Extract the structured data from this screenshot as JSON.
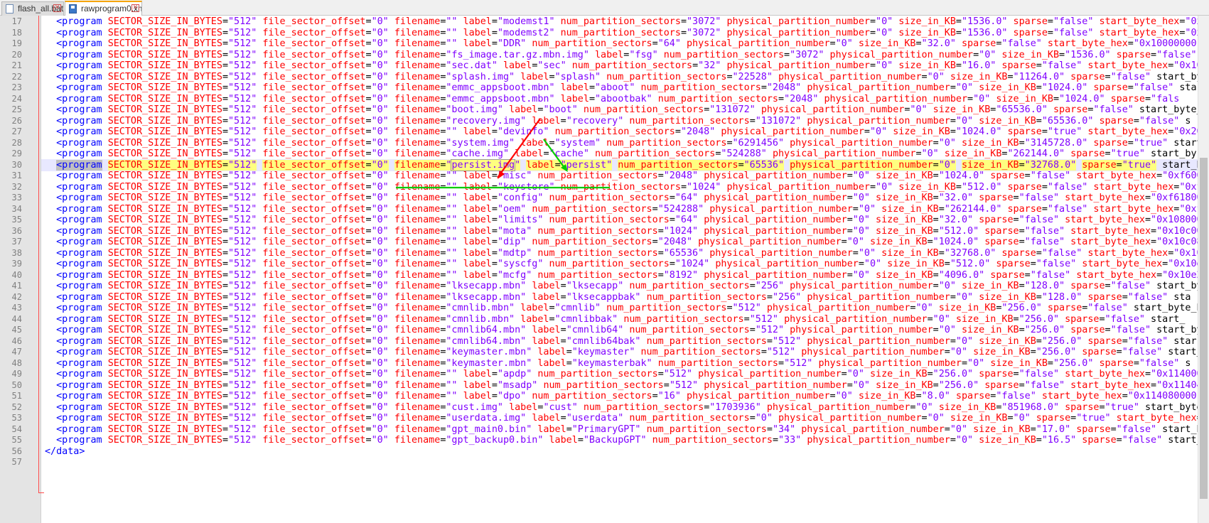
{
  "tabs": [
    {
      "label": "flash_all.bat",
      "active": false
    },
    {
      "label": "rawprogram0.xml",
      "active": true
    }
  ],
  "colors": {
    "tag": "#0000ff",
    "attribute": "#ff0000",
    "value": "#8000ff",
    "current_line": "#e8e8ff",
    "fold_marker": "#ff4a4a",
    "arrow_red": "#ff0000",
    "arrow_green": "#00cc00"
  },
  "editor": {
    "current_line": 30,
    "highlight_value": "persist.img",
    "lines": [
      {
        "n": "17",
        "code": "  <program SECTOR_SIZE_IN_BYTES=\"512\" file_sector_offset=\"0\" filename=\"\" label=\"modemst1\" num_partition_sectors=\"3072\" physical_partition_number=\"0\" size_in_KB=\"1536.0\" sparse=\"false\" start_byte_hex=\"0xc"
      },
      {
        "n": "18",
        "code": "  <program SECTOR_SIZE_IN_BYTES=\"512\" file_sector_offset=\"0\" filename=\"\" label=\"modemst2\" num_partition_sectors=\"3072\" physical_partition_number=\"0\" size_in_KB=\"1536.0\" sparse=\"false\" start_byte_hex=\"0xc"
      },
      {
        "n": "19",
        "code": "  <program SECTOR_SIZE_IN_BYTES=\"512\" file_sector_offset=\"0\" filename=\"\" label=\"DDR\" num_partition_sectors=\"64\" physical_partition_number=\"0\" size_in_KB=\"32.0\" sparse=\"false\" start_byte_hex=\"0x10000000"
      },
      {
        "n": "20",
        "code": "  <program SECTOR_SIZE_IN_BYTES=\"512\" file_sector_offset=\"0\" filename=\"fs_image.tar.gz.mbn.img\" label=\"fsg\" num_partition_sectors=\"3072\" physical_partition_number=\"0\" size_in_KB=\"1536.0\" sparse=\"false\" s"
      },
      {
        "n": "21",
        "code": "  <program SECTOR_SIZE_IN_BYTES=\"512\" file_sector_offset=\"0\" filename=\"sec.dat\" label=\"sec\" num_partition_sectors=\"32\" physical_partition_number=\"0\" size_in_KB=\"16.0\" sparse=\"false\" start_byte_hex=\"0x101"
      },
      {
        "n": "22",
        "code": "  <program SECTOR_SIZE_IN_BYTES=\"512\" file_sector_offset=\"0\" filename=\"splash.img\" label=\"splash\" num_partition_sectors=\"22528\" physical_partition_number=\"0\" size_in_KB=\"11264.0\" sparse=\"false\" start_byt"
      },
      {
        "n": "23",
        "code": "  <program SECTOR_SIZE_IN_BYTES=\"512\" file_sector_offset=\"0\" filename=\"emmc_appsboot.mbn\" label=\"aboot\" num_partition_sectors=\"2048\" physical_partition_number=\"0\" size_in_KB=\"1024.0\" sparse=\"false\" start"
      },
      {
        "n": "24",
        "code": "  <program SECTOR_SIZE_IN_BYTES=\"512\" file_sector_offset=\"0\" filename=\"emmc_appsboot.mbn\" label=\"abootbak\" num_partition_sectors=\"2048\" physical_partition_number=\"0\" size_in_KB=\"1024.0\" sparse=\"fals"
      },
      {
        "n": "25",
        "code": "  <program SECTOR_SIZE_IN_BYTES=\"512\" file_sector_offset=\"0\" filename=\"boot.img\" label=\"boot\" num_partition_sectors=\"131072\" physical_partition_number=\"0\" size_in_KB=\"65536.0\" sparse=\"false\" start_byte_h"
      },
      {
        "n": "26",
        "code": "  <program SECTOR_SIZE_IN_BYTES=\"512\" file_sector_offset=\"0\" filename=\"recovery.img\" label=\"recovery\" num_partition_sectors=\"131072\" physical_partition_number=\"0\" size_in_KB=\"65536.0\" sparse=\"false\" s"
      },
      {
        "n": "27",
        "code": "  <program SECTOR_SIZE_IN_BYTES=\"512\" file_sector_offset=\"0\" filename=\"\" label=\"devinfo\" num_partition_sectors=\"2048\" physical_partition_number=\"0\" size_in_KB=\"1024.0\" sparse=\"true\" start_byte_hex=\"0x202"
      },
      {
        "n": "28",
        "code": "  <program SECTOR_SIZE_IN_BYTES=\"512\" file_sector_offset=\"0\" filename=\"system.img\" label=\"system\" num_partition_sectors=\"6291456\" physical_partition_number=\"0\" size_in_KB=\"3145728.0\" sparse=\"true\" start_"
      },
      {
        "n": "29",
        "code": "  <program SECTOR_SIZE_IN_BYTES=\"512\" file_sector_offset=\"0\" filename=\"cache.img\" label=\"cache\" num_partition_sectors=\"524288\" physical_partition_number=\"0\" size_in_KB=\"262144.0\" sparse=\"true\" start_by"
      },
      {
        "n": "30",
        "code": "  <program SECTOR_SIZE_IN_BYTES=\"512\" file_sector_offset=\"0\" filename=\"persist.img\" label=\"persist\" num_partition_sectors=\"65536\" physical_partition_number=\"0\" size_in_KB=\"32768.0\" sparse=\"true\" start_by"
      },
      {
        "n": "31",
        "code": "  <program SECTOR_SIZE_IN_BYTES=\"512\" file_sector_offset=\"0\" filename=\"\" label=\"misc\" num_partition_sectors=\"2048\" physical_partition_number=\"0\" size_in_KB=\"1024.0\" sparse=\"false\" start_byte_hex=\"0xf6000"
      },
      {
        "n": "32",
        "code": "  <program SECTOR_SIZE_IN_BYTES=\"512\" file_sector_offset=\"0\" filename=\"\" label=\"keystore\" num_partition_sectors=\"1024\" physical_partition_number=\"0\" size_in_KB=\"512.0\" sparse=\"false\" start_byte_hex=\"0xf6"
      },
      {
        "n": "33",
        "code": "  <program SECTOR_SIZE_IN_BYTES=\"512\" file_sector_offset=\"0\" filename=\"\" label=\"config\" num_partition_sectors=\"64\" physical_partition_number=\"0\" size_in_KB=\"32.0\" sparse=\"false\" start_byte_hex=\"0xf61800"
      },
      {
        "n": "34",
        "code": "  <program SECTOR_SIZE_IN_BYTES=\"512\" file_sector_offset=\"0\" filename=\"\" label=\"oem\" num_partition_sectors=\"524288\" physical_partition_number=\"0\" size_in_KB=\"262144.0\" sparse=\"false\" start_byte_hex=\"0xf6"
      },
      {
        "n": "35",
        "code": "  <program SECTOR_SIZE_IN_BYTES=\"512\" file_sector_offset=\"0\" filename=\"\" label=\"limits\" num_partition_sectors=\"64\" physical_partition_number=\"0\" size_in_KB=\"32.0\" sparse=\"false\" start_byte_hex=\"0x108000"
      },
      {
        "n": "36",
        "code": "  <program SECTOR_SIZE_IN_BYTES=\"512\" file_sector_offset=\"0\" filename=\"\" label=\"mota\" num_partition_sectors=\"1024\" physical_partition_number=\"0\" size_in_KB=\"512.0\" sparse=\"false\" start_byte_hex=\"0x10c00"
      },
      {
        "n": "37",
        "code": "  <program SECTOR_SIZE_IN_BYTES=\"512\" file_sector_offset=\"0\" filename=\"\" label=\"dip\" num_partition_sectors=\"2048\" physical_partition_number=\"0\" size_in_KB=\"1024.0\" sparse=\"false\" start_byte_hex=\"0x10c08"
      },
      {
        "n": "38",
        "code": "  <program SECTOR_SIZE_IN_BYTES=\"512\" file_sector_offset=\"0\" filename=\"\" label=\"mdtp\" num_partition_sectors=\"65536\" physical_partition_number=\"0\" size_in_KB=\"32768.0\" sparse=\"false\" start_byte_hex=\"0x10c"
      },
      {
        "n": "39",
        "code": "  <program SECTOR_SIZE_IN_BYTES=\"512\" file_sector_offset=\"0\" filename=\"\" label=\"syscfg\" num_partition_sectors=\"1024\" physical_partition_number=\"0\" size_in_KB=\"512.0\" sparse=\"false\" start_byte_hex=\"0x10e1"
      },
      {
        "n": "40",
        "code": "  <program SECTOR_SIZE_IN_BYTES=\"512\" file_sector_offset=\"0\" filename=\"\" label=\"mcfg\" num_partition_sectors=\"8192\" physical_partition_number=\"0\" size_in_KB=\"4096.0\" sparse=\"false\" start_byte_hex=\"0x10e2"
      },
      {
        "n": "41",
        "code": "  <program SECTOR_SIZE_IN_BYTES=\"512\" file_sector_offset=\"0\" filename=\"lksecapp.mbn\" label=\"lksecapp\" num_partition_sectors=\"256\" physical_partition_number=\"0\" size_in_KB=\"128.0\" sparse=\"false\" start_byt"
      },
      {
        "n": "42",
        "code": "  <program SECTOR_SIZE_IN_BYTES=\"512\" file_sector_offset=\"0\" filename=\"lksecapp.mbn\" label=\"lksecappbak\" num_partition_sectors=\"256\" physical_partition_number=\"0\" size_in_KB=\"128.0\" sparse=\"false\" sta"
      },
      {
        "n": "43",
        "code": "  <program SECTOR_SIZE_IN_BYTES=\"512\" file_sector_offset=\"0\" filename=\"cmnlib.mbn\" label=\"cmnlib\" num_partition_sectors=\"512\" physical_partition_number=\"0\" size_in_KB=\"256.0\" sparse=\"false\" start_byte_he"
      },
      {
        "n": "44",
        "code": "  <program SECTOR_SIZE_IN_BYTES=\"512\" file_sector_offset=\"0\" filename=\"cmnlib.mbn\" label=\"cmnlibbak\" num_partition_sectors=\"512\" physical_partition_number=\"0\" size_in_KB=\"256.0\" sparse=\"false\" start_"
      },
      {
        "n": "45",
        "code": "  <program SECTOR_SIZE_IN_BYTES=\"512\" file_sector_offset=\"0\" filename=\"cmnlib64.mbn\" label=\"cmnlib64\" num_partition_sectors=\"512\" physical_partition_number=\"0\" size_in_KB=\"256.0\" sparse=\"false\" start_byt"
      },
      {
        "n": "46",
        "code": "  <program SECTOR_SIZE_IN_BYTES=\"512\" file_sector_offset=\"0\" filename=\"cmnlib64.mbn\" label=\"cmnlib64bak\" num_partition_sectors=\"512\" physical_partition_number=\"0\" size_in_KB=\"256.0\" sparse=\"false\" star"
      },
      {
        "n": "47",
        "code": "  <program SECTOR_SIZE_IN_BYTES=\"512\" file_sector_offset=\"0\" filename=\"keymaster.mbn\" label=\"keymaster\" num_partition_sectors=\"512\" physical_partition_number=\"0\" size_in_KB=\"256.0\" sparse=\"false\" start_"
      },
      {
        "n": "48",
        "code": "  <program SECTOR_SIZE_IN_BYTES=\"512\" file_sector_offset=\"0\" filename=\"keymaster.mbn\" label=\"keymasterbak\" num_partition_sectors=\"512\" physical_partition_number=\"0\" size_in_KB=\"256.0\" sparse=\"false\" s"
      },
      {
        "n": "49",
        "code": "  <program SECTOR_SIZE_IN_BYTES=\"512\" file_sector_offset=\"0\" filename=\"\" label=\"apdp\" num_partition_sectors=\"512\" physical_partition_number=\"0\" size_in_KB=\"256.0\" sparse=\"false\" start_byte_hex=\"0x114000"
      },
      {
        "n": "50",
        "code": "  <program SECTOR_SIZE_IN_BYTES=\"512\" file_sector_offset=\"0\" filename=\"\" label=\"msadp\" num_partition_sectors=\"512\" physical_partition_number=\"0\" size_in_KB=\"256.0\" sparse=\"false\" start_byte_hex=\"0x11404"
      },
      {
        "n": "51",
        "code": "  <program SECTOR_SIZE_IN_BYTES=\"512\" file_sector_offset=\"0\" filename=\"\" label=\"dpo\" num_partition_sectors=\"16\" physical_partition_number=\"0\" size_in_KB=\"8.0\" sparse=\"false\" start_byte_hex=\"0x114080000"
      },
      {
        "n": "52",
        "code": "  <program SECTOR_SIZE_IN_BYTES=\"512\" file_sector_offset=\"0\" filename=\"cust.img\" label=\"cust\" num_partition_sectors=\"1703936\" physical_partition_number=\"0\" size_in_KB=\"851968.0\" sparse=\"true\" start_byte_"
      },
      {
        "n": "53",
        "code": "  <program SECTOR_SIZE_IN_BYTES=\"512\" file_sector_offset=\"0\" filename=\"userdata.img\" label=\"userdata\" num_partition_sectors=\"0\" physical_partition_number=\"0\" size_in_KB=\"0\" sparse=\"true\" start_byte_hex=\""
      },
      {
        "n": "54",
        "code": "  <program SECTOR_SIZE_IN_BYTES=\"512\" file_sector_offset=\"0\" filename=\"gpt_main0.bin\" label=\"PrimaryGPT\" num_partition_sectors=\"34\" physical_partition_number=\"0\" size_in_KB=\"17.0\" sparse=\"false\" start_by"
      },
      {
        "n": "55",
        "code": "  <program SECTOR_SIZE_IN_BYTES=\"512\" file_sector_offset=\"0\" filename=\"gpt_backup0.bin\" label=\"BackupGPT\" num_partition_sectors=\"33\" physical_partition_number=\"0\" size_in_KB=\"16.5\" sparse=\"false\" start_b"
      },
      {
        "n": "56",
        "code": "</data>"
      },
      {
        "n": "57",
        "code": ""
      }
    ]
  }
}
